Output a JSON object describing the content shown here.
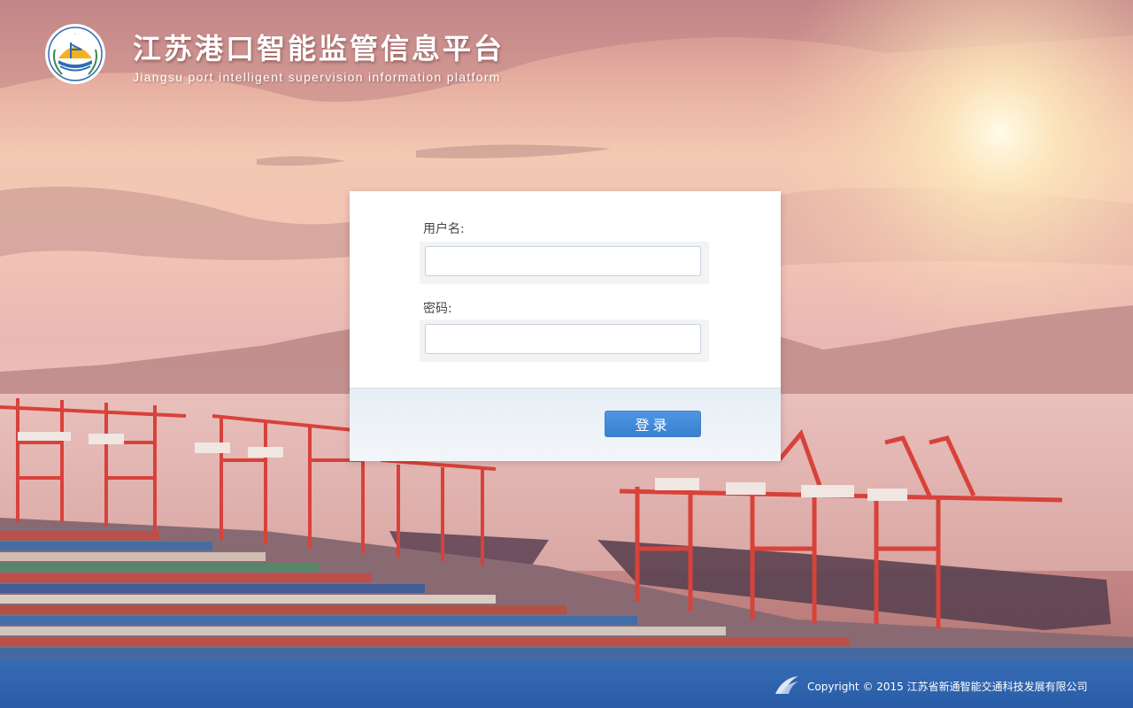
{
  "header": {
    "logo_icon": "port-emblem-icon",
    "title": "江苏港口智能监管信息平台",
    "subtitle": "Jiangsu port intelligent supervision information platform"
  },
  "login": {
    "username_label": "用户名:",
    "username_value": "",
    "password_label": "密码:",
    "password_value": "",
    "submit_label": "登录",
    "accent_color": "#3a7fd0"
  },
  "footer": {
    "icon": "company-logo-icon",
    "copyright": "Copyright © 2015 江苏省新通智能交通科技发展有限公司"
  }
}
